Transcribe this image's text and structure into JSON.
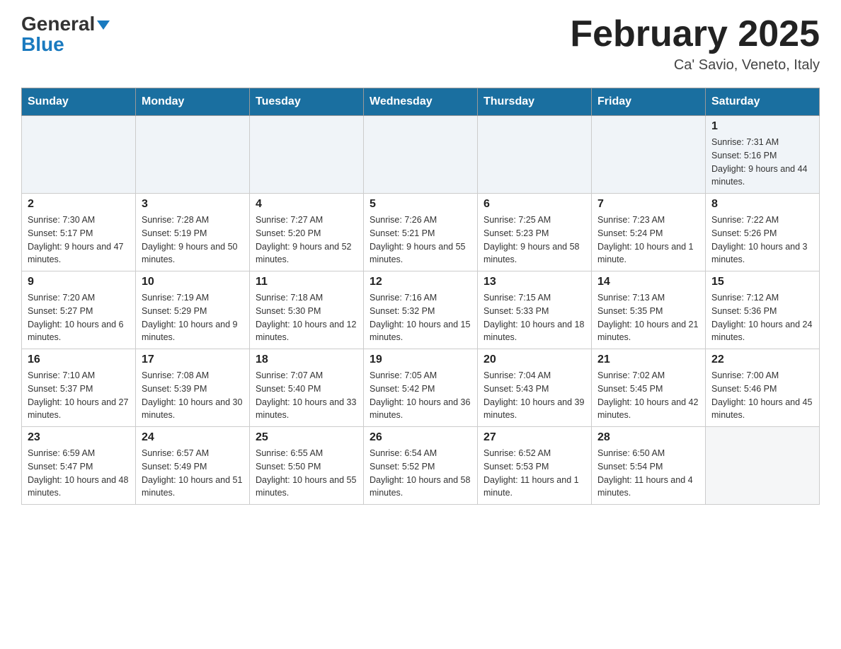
{
  "header": {
    "logo_line1": "General",
    "logo_line2": "Blue",
    "month_title": "February 2025",
    "location": "Ca' Savio, Veneto, Italy"
  },
  "days_of_week": [
    "Sunday",
    "Monday",
    "Tuesday",
    "Wednesday",
    "Thursday",
    "Friday",
    "Saturday"
  ],
  "weeks": [
    [
      {
        "day": "",
        "info": ""
      },
      {
        "day": "",
        "info": ""
      },
      {
        "day": "",
        "info": ""
      },
      {
        "day": "",
        "info": ""
      },
      {
        "day": "",
        "info": ""
      },
      {
        "day": "",
        "info": ""
      },
      {
        "day": "1",
        "info": "Sunrise: 7:31 AM\nSunset: 5:16 PM\nDaylight: 9 hours and 44 minutes."
      }
    ],
    [
      {
        "day": "2",
        "info": "Sunrise: 7:30 AM\nSunset: 5:17 PM\nDaylight: 9 hours and 47 minutes."
      },
      {
        "day": "3",
        "info": "Sunrise: 7:28 AM\nSunset: 5:19 PM\nDaylight: 9 hours and 50 minutes."
      },
      {
        "day": "4",
        "info": "Sunrise: 7:27 AM\nSunset: 5:20 PM\nDaylight: 9 hours and 52 minutes."
      },
      {
        "day": "5",
        "info": "Sunrise: 7:26 AM\nSunset: 5:21 PM\nDaylight: 9 hours and 55 minutes."
      },
      {
        "day": "6",
        "info": "Sunrise: 7:25 AM\nSunset: 5:23 PM\nDaylight: 9 hours and 58 minutes."
      },
      {
        "day": "7",
        "info": "Sunrise: 7:23 AM\nSunset: 5:24 PM\nDaylight: 10 hours and 1 minute."
      },
      {
        "day": "8",
        "info": "Sunrise: 7:22 AM\nSunset: 5:26 PM\nDaylight: 10 hours and 3 minutes."
      }
    ],
    [
      {
        "day": "9",
        "info": "Sunrise: 7:20 AM\nSunset: 5:27 PM\nDaylight: 10 hours and 6 minutes."
      },
      {
        "day": "10",
        "info": "Sunrise: 7:19 AM\nSunset: 5:29 PM\nDaylight: 10 hours and 9 minutes."
      },
      {
        "day": "11",
        "info": "Sunrise: 7:18 AM\nSunset: 5:30 PM\nDaylight: 10 hours and 12 minutes."
      },
      {
        "day": "12",
        "info": "Sunrise: 7:16 AM\nSunset: 5:32 PM\nDaylight: 10 hours and 15 minutes."
      },
      {
        "day": "13",
        "info": "Sunrise: 7:15 AM\nSunset: 5:33 PM\nDaylight: 10 hours and 18 minutes."
      },
      {
        "day": "14",
        "info": "Sunrise: 7:13 AM\nSunset: 5:35 PM\nDaylight: 10 hours and 21 minutes."
      },
      {
        "day": "15",
        "info": "Sunrise: 7:12 AM\nSunset: 5:36 PM\nDaylight: 10 hours and 24 minutes."
      }
    ],
    [
      {
        "day": "16",
        "info": "Sunrise: 7:10 AM\nSunset: 5:37 PM\nDaylight: 10 hours and 27 minutes."
      },
      {
        "day": "17",
        "info": "Sunrise: 7:08 AM\nSunset: 5:39 PM\nDaylight: 10 hours and 30 minutes."
      },
      {
        "day": "18",
        "info": "Sunrise: 7:07 AM\nSunset: 5:40 PM\nDaylight: 10 hours and 33 minutes."
      },
      {
        "day": "19",
        "info": "Sunrise: 7:05 AM\nSunset: 5:42 PM\nDaylight: 10 hours and 36 minutes."
      },
      {
        "day": "20",
        "info": "Sunrise: 7:04 AM\nSunset: 5:43 PM\nDaylight: 10 hours and 39 minutes."
      },
      {
        "day": "21",
        "info": "Sunrise: 7:02 AM\nSunset: 5:45 PM\nDaylight: 10 hours and 42 minutes."
      },
      {
        "day": "22",
        "info": "Sunrise: 7:00 AM\nSunset: 5:46 PM\nDaylight: 10 hours and 45 minutes."
      }
    ],
    [
      {
        "day": "23",
        "info": "Sunrise: 6:59 AM\nSunset: 5:47 PM\nDaylight: 10 hours and 48 minutes."
      },
      {
        "day": "24",
        "info": "Sunrise: 6:57 AM\nSunset: 5:49 PM\nDaylight: 10 hours and 51 minutes."
      },
      {
        "day": "25",
        "info": "Sunrise: 6:55 AM\nSunset: 5:50 PM\nDaylight: 10 hours and 55 minutes."
      },
      {
        "day": "26",
        "info": "Sunrise: 6:54 AM\nSunset: 5:52 PM\nDaylight: 10 hours and 58 minutes."
      },
      {
        "day": "27",
        "info": "Sunrise: 6:52 AM\nSunset: 5:53 PM\nDaylight: 11 hours and 1 minute."
      },
      {
        "day": "28",
        "info": "Sunrise: 6:50 AM\nSunset: 5:54 PM\nDaylight: 11 hours and 4 minutes."
      },
      {
        "day": "",
        "info": ""
      }
    ]
  ]
}
